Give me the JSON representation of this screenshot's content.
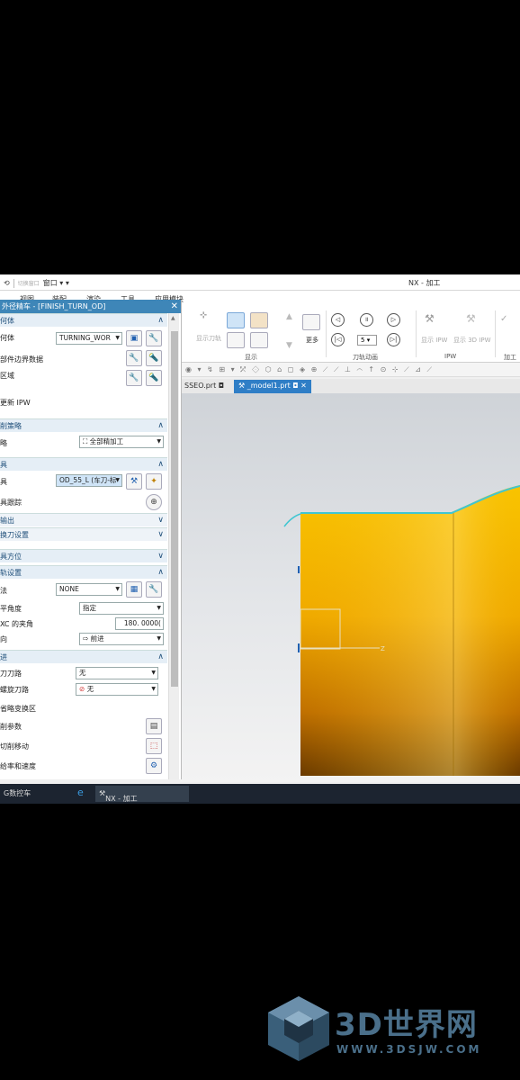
{
  "titlebar": {
    "switch_window": "切换窗口",
    "window_menu": "窗口 ▾ ▾",
    "app_title": "NX - 加工"
  },
  "menu_tabs": [
    "视图",
    "装配",
    "渲染",
    "工具",
    "应用模块"
  ],
  "ribbon": {
    "btn_show_toolpath": "显示刀轨",
    "group_display": "显示",
    "more": "更多",
    "group_toolpath_anim": "刀轨动画",
    "speed_value": "5",
    "show_ipw": "显示 IPW",
    "show_3d_ipw": "显示 3D IPW",
    "group_ipw": "IPW",
    "group_machining": "加工"
  },
  "doc_tabs": [
    {
      "label": "SSEO.prt",
      "active": false
    },
    {
      "label": "_model1.prt",
      "active": true
    }
  ],
  "dialog": {
    "title": "外径精车 - [FINISH_TURN_OD]",
    "sections": {
      "geometry": "何体",
      "geometry_label": "何体",
      "geometry_value": "TURNING_WOR",
      "boundary_label": "部件边界数据",
      "region_label": "区域",
      "update_ipw": "更新 IPW",
      "strategy": "削策略",
      "strategy_label": "略",
      "strategy_value": "全部精加工",
      "tool": "具",
      "tool_label": "具",
      "tool_value": "OD_55_L (车刀-标",
      "tracking_label": "具跟踪",
      "output": "输出",
      "change_tool": "换刀设置",
      "tool_orient": "具方位",
      "tool_axis": "轨设置",
      "method_label": "法",
      "method_value": "NONE",
      "level_angle_label": "平角度",
      "level_angle_value": "指定",
      "xc_angle_label": "XC 的夹角",
      "xc_angle_value": "180. 0000(",
      "direction_label": "向",
      "direction_value": "前进",
      "stepover": "进",
      "cut_path_label": "刀刀路",
      "cut_path_value": "无",
      "spiral_label": "螺旋刀路",
      "spiral_value": "无",
      "omit_zone_label": "省略变换区",
      "cut_params_label": "削参数",
      "noncut_label": "切削移动",
      "feeds_label": "给率和速度"
    }
  },
  "taskbar": {
    "item1": "G数控车",
    "item2": "NX - 加工"
  },
  "watermark": {
    "brand": "3D世界网",
    "url": "WWW.3DSJW.COM"
  },
  "colors": {
    "dialog_header": "#3e86b8",
    "section_header_bg": "#e5eef6",
    "part_gold": "#f5b800",
    "toolpath": "#3fc6d2"
  }
}
